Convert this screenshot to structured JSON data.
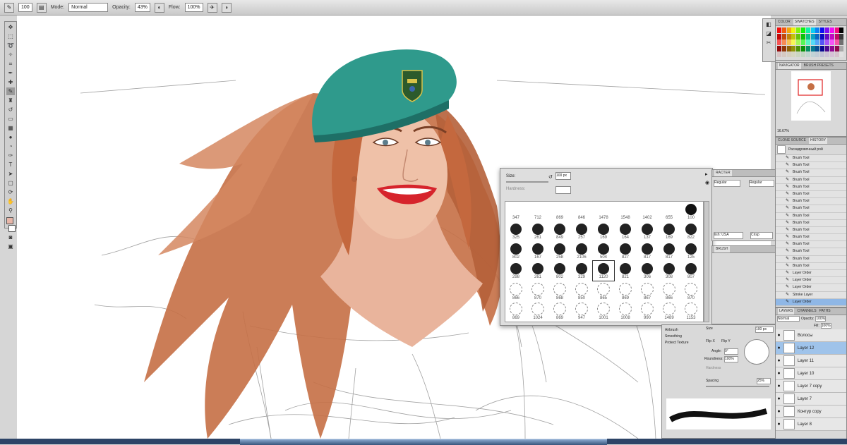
{
  "options": {
    "size_value": "100",
    "mode_label": "Mode:",
    "mode_value": "Normal",
    "opacity_label": "Opacity:",
    "opacity_value": "43%",
    "flow_label": "Flow:",
    "flow_value": "100%"
  },
  "swatches_panel": {
    "tabs": [
      "COLOR",
      "SWATCHES",
      "STYLES"
    ]
  },
  "navigator_panel": {
    "tabs": [
      "NAVIGATOR",
      "BRUSH PRESETS"
    ],
    "zoom": "16.67%"
  },
  "clone_panel": {
    "tabs": [
      "CLONE SOURCE",
      "HISTORY"
    ],
    "snapshot_label": "Раскадровочный рой"
  },
  "history": [
    "Brush Tool",
    "Brush Tool",
    "Brush Tool",
    "Brush Tool",
    "Brush Tool",
    "Brush Tool",
    "Brush Tool",
    "Brush Tool",
    "Brush Tool",
    "Brush Tool",
    "Brush Tool",
    "Brush Tool",
    "Brush Tool",
    "Brush Tool",
    "Brush Tool",
    "Brush Tool",
    "Layer Order",
    "Layer Order",
    "Layer Order",
    "Stroke Layer",
    "Layer Order"
  ],
  "layers_panel": {
    "tabs": [
      "LAYERS",
      "CHANNELS",
      "PATHS"
    ],
    "blend_mode": "Normal",
    "opacity_label": "Opacity:",
    "opacity_value": "100%",
    "fill_label": "Fill:",
    "fill_value": "100%",
    "layers": [
      "Волосы",
      "Layer 12",
      "Layer 11",
      "Layer 10",
      "Layer 7 copy",
      "Layer 7",
      "Контур copy",
      "Layer 8"
    ],
    "selected_index": 1
  },
  "brush_picker": {
    "size_label": "Size:",
    "size_value": "100 px",
    "hardness_label": "Hardness:",
    "cells": [
      "347",
      "712",
      "869",
      "846",
      "1478",
      "1548",
      "1402",
      "655",
      "100",
      "325",
      "261",
      "849",
      "257",
      "169",
      "164",
      "137",
      "169",
      "822",
      "802",
      "167",
      "258",
      "2106",
      "504",
      "827",
      "817",
      "817",
      "125",
      "298",
      "261",
      "802",
      "329",
      "1120",
      "821",
      "306",
      "308",
      "807",
      "866",
      "870",
      "868",
      "850",
      "865",
      "869",
      "867",
      "866",
      "870",
      "869",
      "1024",
      "869",
      "947",
      "1001",
      "1008",
      "990",
      "1489",
      "1153"
    ]
  },
  "character_panel": {
    "font": "Regular",
    "lang": "lish: USA",
    "aa": "Crisp"
  },
  "brush_panel": {
    "airbrush": "Airbrush",
    "smoothing": "Smoothing",
    "protect": "Protect Texture",
    "size_label": "Size",
    "size_value": "100 px",
    "flip_x": "Flip X",
    "flip_y": "Flip Y",
    "angle_label": "Angle:",
    "angle_value": "0°",
    "roundness_label": "Roundness:",
    "roundness_value": "100%",
    "hardness_label": "Hardness",
    "spacing_label": "Spacing",
    "spacing_value": "25%"
  },
  "colors": {
    "beret": "#2f9a8c",
    "hair": "#c56f45",
    "skin": "#e9b49c",
    "lips": "#d6242c",
    "selection": "#9fc3ea"
  },
  "icons": [
    "brush-icon",
    "move-icon",
    "marquee-icon",
    "lasso-icon",
    "wand-icon",
    "crop-icon",
    "eyedropper-icon",
    "heal-icon",
    "stamp-icon",
    "eraser-icon",
    "gradient-icon",
    "dodge-icon",
    "pen-icon",
    "text-icon",
    "path-icon",
    "shape-icon",
    "hand-icon",
    "zoom-icon"
  ]
}
